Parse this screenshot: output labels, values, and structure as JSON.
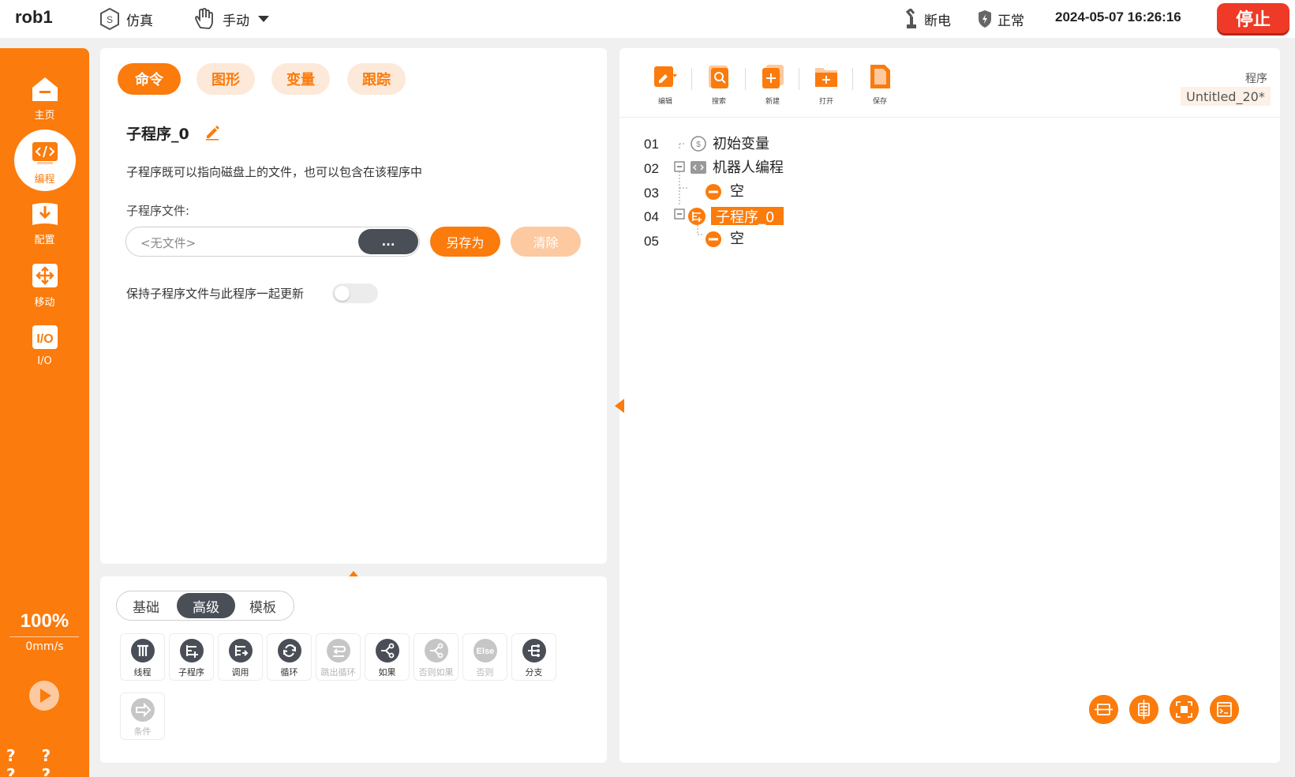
{
  "topbar": {
    "robot_name": "rob1",
    "mode_sim": "仿真",
    "mode_manual": "手动",
    "power_status": "断电",
    "safety_status": "正常",
    "datetime": "2024-05-07 16:26:16",
    "stop_label": "停止"
  },
  "nav": {
    "items": [
      {
        "label": "主页",
        "icon": "home-icon"
      },
      {
        "label": "编程",
        "icon": "code-icon",
        "active": true
      },
      {
        "label": "配置",
        "icon": "config-icon"
      },
      {
        "label": "移动",
        "icon": "move-icon"
      },
      {
        "label": "I/O",
        "icon": "io-icon"
      }
    ],
    "speed_percent": "100%",
    "speed_value": "0mm/s",
    "help_marks": "? ? ? ?"
  },
  "command_panel": {
    "tabs": [
      {
        "label": "命令",
        "active": true
      },
      {
        "label": "图形"
      },
      {
        "label": "变量"
      },
      {
        "label": "跟踪"
      }
    ],
    "title": "子程序_0",
    "description": "子程序既可以指向磁盘上的文件，也可以包含在该程序中",
    "file_label": "子程序文件:",
    "file_placeholder": "<无文件>",
    "browse_label": "...",
    "save_as_label": "另存为",
    "clear_label": "清除",
    "keep_updated_label": "保持子程序文件与此程序一起更新",
    "keep_updated_on": false
  },
  "palette": {
    "segments": [
      {
        "label": "基础"
      },
      {
        "label": "高级",
        "active": true
      },
      {
        "label": "模板"
      }
    ],
    "commands": [
      {
        "label": "线程",
        "icon": "thread-icon",
        "enabled": true
      },
      {
        "label": "子程序",
        "icon": "subprogram-icon",
        "enabled": true
      },
      {
        "label": "调用",
        "icon": "call-icon",
        "enabled": true
      },
      {
        "label": "循环",
        "icon": "loop-icon",
        "enabled": true
      },
      {
        "label": "跳出循环",
        "icon": "break-loop-icon",
        "enabled": false
      },
      {
        "label": "如果",
        "icon": "if-icon",
        "enabled": true
      },
      {
        "label": "否则如果",
        "icon": "elseif-icon",
        "enabled": false
      },
      {
        "label": "否则",
        "icon": "else-icon",
        "icon_text": "Else",
        "enabled": false
      },
      {
        "label": "分支",
        "icon": "switch-icon",
        "enabled": true
      },
      {
        "label": "条件",
        "icon": "condition-icon",
        "enabled": false
      }
    ]
  },
  "program_panel": {
    "toolbar": [
      {
        "label": "编辑",
        "icon": "edit-icon"
      },
      {
        "label": "搜索",
        "icon": "search-icon"
      },
      {
        "label": "新建",
        "icon": "new-file-icon"
      },
      {
        "label": "打开",
        "icon": "open-folder-icon"
      },
      {
        "label": "保存",
        "icon": "save-icon"
      }
    ],
    "program_label": "程序",
    "program_name": "Untitled_20*",
    "tree": [
      {
        "line": "01",
        "text": "初始变量"
      },
      {
        "line": "02",
        "text": "机器人编程"
      },
      {
        "line": "03",
        "text": "空"
      },
      {
        "line": "04",
        "text": "子程序_0",
        "selected": true
      },
      {
        "line": "05",
        "text": "空"
      }
    ]
  },
  "colors": {
    "accent": "#fb7b0c",
    "stop": "#ee3a26",
    "dark": "#4a4e57"
  }
}
